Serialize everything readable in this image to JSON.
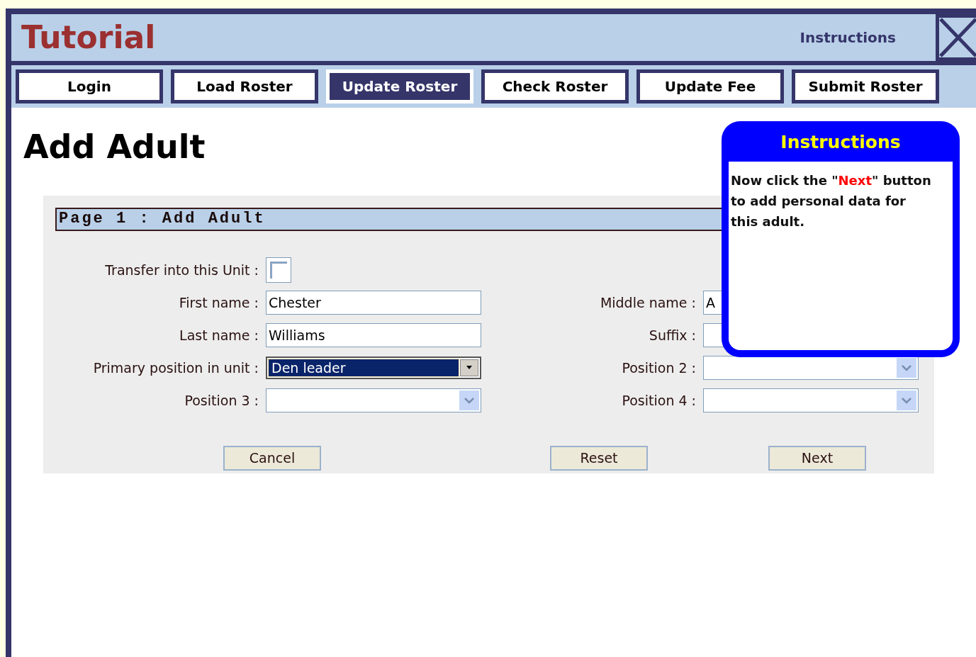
{
  "header": {
    "title": "Tutorial",
    "instructions_link": "Instructions"
  },
  "tabs": [
    {
      "label": "Login",
      "selected": false
    },
    {
      "label": "Load Roster",
      "selected": false
    },
    {
      "label": "Update Roster",
      "selected": true
    },
    {
      "label": "Check Roster",
      "selected": false
    },
    {
      "label": "Update Fee",
      "selected": false
    },
    {
      "label": "Submit Roster",
      "selected": false
    }
  ],
  "page_title": "Add Adult",
  "form": {
    "section_title": "Page 1 : Add Adult",
    "rows": [
      {
        "left": {
          "label": "Transfer into this Unit :",
          "kind": "checkbox",
          "checked": false
        }
      },
      {
        "left": {
          "label": "First name :",
          "kind": "text",
          "value": "Chester"
        },
        "right": {
          "label": "Middle name :",
          "kind": "text",
          "value": "A"
        }
      },
      {
        "left": {
          "label": "Last name :",
          "kind": "text",
          "value": "Williams"
        },
        "right": {
          "label": "Suffix :",
          "kind": "text"
        }
      },
      {
        "left": {
          "label": "Primary position in unit :",
          "kind": "select",
          "value": "Den leader",
          "focused": true
        },
        "right": {
          "label": "Position 2 :",
          "kind": "select",
          "focused": false
        }
      },
      {
        "left": {
          "label": "Position 3 :",
          "kind": "select",
          "focused": false
        },
        "right": {
          "label": "Position 4 :",
          "kind": "select",
          "focused": false
        }
      }
    ],
    "buttons": [
      "Cancel",
      "Reset",
      "Next"
    ]
  },
  "instructions_popup": {
    "title": "Instructions",
    "message": [
      {
        "text": "Now click the  \"",
        "highlight": false
      },
      {
        "text": "Next",
        "highlight": true
      },
      {
        "text": "\" button to add personal data for this adult.",
        "highlight": false
      }
    ]
  }
}
